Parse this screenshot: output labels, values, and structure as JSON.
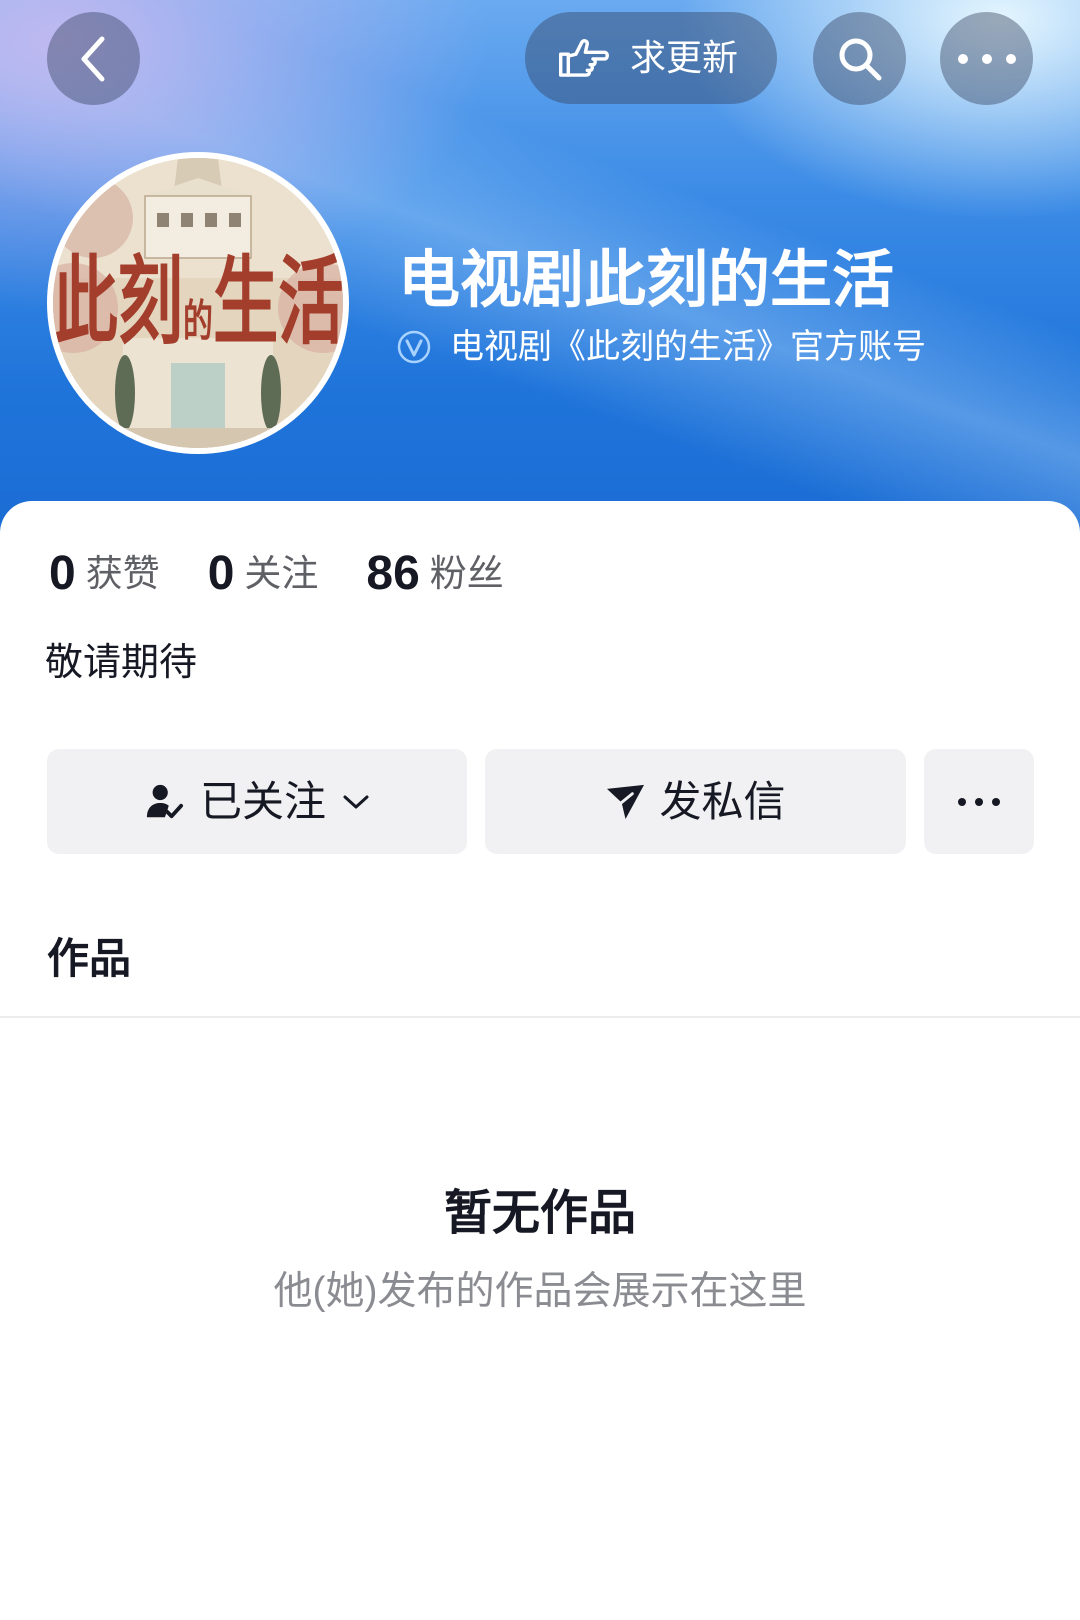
{
  "top_bar": {
    "request_update_label": "求更新"
  },
  "profile": {
    "avatar": {
      "title_parts": [
        "此刻",
        "的",
        "生活"
      ]
    },
    "name": "电视剧此刻的生活",
    "verified_description": "电视剧《此刻的生活》官方账号",
    "stats": [
      {
        "value": "0",
        "label": "获赞"
      },
      {
        "value": "0",
        "label": "关注"
      },
      {
        "value": "86",
        "label": "粉丝"
      }
    ],
    "bio": "敬请期待"
  },
  "actions": {
    "follow_label": "已关注",
    "message_label": "发私信"
  },
  "works": {
    "tab_label": "作品",
    "empty_title": "暂无作品",
    "empty_subtitle": "他(她)发布的作品会展示在这里"
  },
  "icons": {
    "back": "chevron-left-icon",
    "request_update": "pointing-hand-icon",
    "search": "search-icon",
    "more": "more-dots-icon",
    "verified": "verified-icon",
    "follow": "person-check-icon",
    "follow_dropdown": "chevron-down-icon",
    "message": "paper-plane-icon",
    "more_actions": "more-dots-icon"
  },
  "colors": {
    "header_blue": "#1a6bd3",
    "header_light": "#6aaaf0",
    "card_background": "#ffffff",
    "button_background": "#f1f1f3",
    "text_primary": "#161823",
    "text_secondary": "#8b8c92",
    "stat_label": "#5f6066",
    "avatar_title_red": "#a33e2c",
    "verified_badge": "#a9d3ff",
    "divider": "#ececee"
  }
}
